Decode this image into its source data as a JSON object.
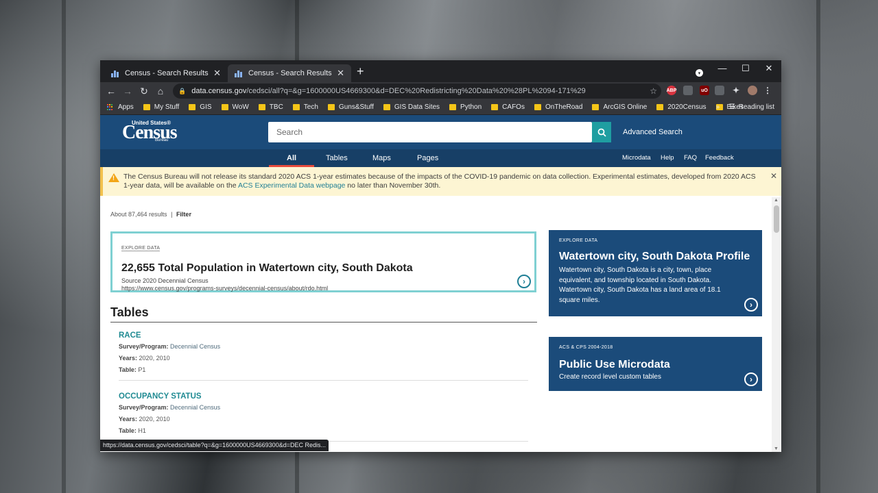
{
  "tabs": [
    {
      "title": "Census - Search Results",
      "active": false
    },
    {
      "title": "Census - Search Results",
      "active": true
    }
  ],
  "toolbar": {
    "url_host": "data.census.gov",
    "url_path": "/cedsci/all?q=&g=1600000US4669300&d=DEC%20Redistricting%20Data%20%28PL%2094-171%29"
  },
  "bookmarks": [
    "Apps",
    "My Stuff",
    "GIS",
    "WoW",
    "TBC",
    "Tech",
    "Guns&Stuff",
    "GIS Data Sites",
    "Python",
    "CAFOs",
    "OnTheRoad",
    "ArcGIS Online",
    "2020Census",
    "Bikes"
  ],
  "bookmarks_more": "»",
  "reading_list": "Reading list",
  "census": {
    "logo_us": "United States®",
    "logo_census": "Census",
    "logo_bureau": "Bureau",
    "search_placeholder": "Search",
    "advanced_search": "Advanced Search",
    "nav": [
      "All",
      "Tables",
      "Maps",
      "Pages"
    ],
    "nav_right": [
      "Microdata",
      "Help",
      "FAQ",
      "Feedback"
    ]
  },
  "banner": {
    "text_before": "The Census Bureau will not release its standard 2020 ACS 1-year estimates because of the impacts of the COVID-19 pandemic on data collection. Experimental estimates, developed from 2020 ACS 1-year data, will be available on the ",
    "link": "ACS Experimental Data webpage",
    "text_after": " no later than November 30th."
  },
  "results": {
    "count": "About 87,464 results",
    "separator": "|",
    "filter": "Filter"
  },
  "explore_card": {
    "label": "EXPLORE DATA",
    "title": "22,655 Total Population in Watertown city, South Dakota",
    "source": "Source 2020 Decennial Census",
    "url": "https://www.census.gov/programs-surveys/decennial-census/about/rdo.html"
  },
  "tables_heading": "Tables",
  "tables": [
    {
      "title": "RACE",
      "survey_label": "Survey/Program:",
      "survey": "Decennial Census",
      "years_label": "Years:",
      "years": "2020, 2010",
      "table_label": "Table:",
      "table": "P1"
    },
    {
      "title": "OCCUPANCY STATUS",
      "survey_label": "Survey/Program:",
      "survey": "Decennial Census",
      "years_label": "Years:",
      "years": "2020, 2010",
      "table_label": "Table:",
      "table": "H1"
    }
  ],
  "profile_card": {
    "label": "EXPLORE DATA",
    "title": "Watertown city, South Dakota Profile",
    "text": "Watertown city, South Dakota is a city, town, place equivalent, and township located in South Dakota. Watertown city, South Dakota has a land area of 18.1 square miles."
  },
  "microdata_card": {
    "label": "ACS & CPS 2004-2018",
    "title": "Public Use Microdata",
    "text": "Create record level custom tables"
  },
  "status_tip": "https://data.census.gov/cedsci/table?q=&g=1600000US4669300&d=DEC Redis...",
  "colors": {
    "census_blue": "#1b4b7a",
    "teal": "#1f9ea1",
    "nav_active_underline": "#e84b3c",
    "banner_bg": "#fdf5d3"
  }
}
